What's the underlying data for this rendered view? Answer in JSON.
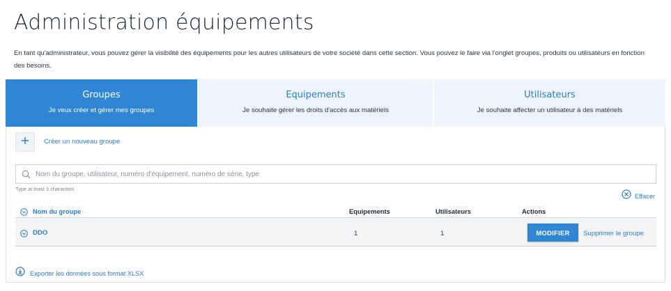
{
  "page": {
    "title": "Administration équipements",
    "intro": "En tant qu'administrateur, vous pouvez gérer la visibilité des équipements pour les autres utilisateurs de votre société dans cette section. Vous pouvez le faire via l'onglet groupes, produits ou utilisateurs en fonction des besoins."
  },
  "tabs": [
    {
      "title": "Groupes",
      "subtitle": "Je veux créer et gérer mes groupes",
      "active": true
    },
    {
      "title": "Equipements",
      "subtitle": "Je souhaite gérer les droits d'accès aux matériels",
      "active": false
    },
    {
      "title": "Utilisateurs",
      "subtitle": "Je souhaite affecter un utilisateur à des matériels",
      "active": false
    }
  ],
  "groups_panel": {
    "add_label": "Créer un nouveau groupe",
    "search_placeholder": "Nom du groupe, utilisateur, numéro d'équipement, numéro de série, type",
    "search_value": "",
    "hint": "Type at least 3 characters",
    "clear_label": "Effacer",
    "columns": {
      "name": "Nom du groupe",
      "equipments": "Equipements",
      "users": "Utilisateurs",
      "actions": "Actions"
    },
    "rows": [
      {
        "name": "DDO",
        "equipments": "1",
        "users": "1",
        "modify_label": "MODIFIER",
        "delete_label": "Supprimer le groupe"
      }
    ],
    "export_label": "Exporter les données sous format XLSX"
  },
  "icons": {
    "add": "plus-icon",
    "search": "search-icon",
    "clear": "close-circle-icon",
    "expand": "chevron-down-circle-icon",
    "export": "download-circle-icon"
  },
  "colors": {
    "accent": "#2f86d4",
    "link": "#2e7bc6",
    "tab_inactive_bg": "#edf4fc",
    "row_bg": "#f4f5f6"
  }
}
